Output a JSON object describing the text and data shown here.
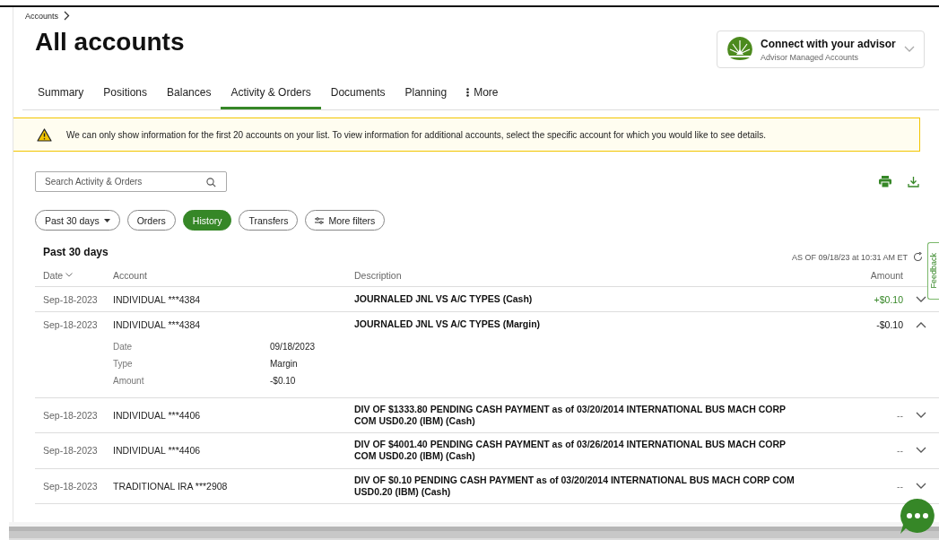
{
  "breadcrumb": {
    "label": "Accounts"
  },
  "page_title": "All accounts",
  "advisor_card": {
    "title": "Connect with your advisor",
    "subtitle": "Advisor Managed Accounts"
  },
  "tabs": [
    {
      "label": "Summary",
      "selected": false
    },
    {
      "label": "Positions",
      "selected": false
    },
    {
      "label": "Balances",
      "selected": false
    },
    {
      "label": "Activity & Orders",
      "selected": true
    },
    {
      "label": "Documents",
      "selected": false
    },
    {
      "label": "Planning",
      "selected": false
    },
    {
      "label": "More",
      "selected": false,
      "kind": "menu"
    }
  ],
  "banner": {
    "text": "We can only show information for the first 20 accounts on your list. To view information for additional accounts, select the specific account for which you would like to see details."
  },
  "search": {
    "placeholder": "Search Activity & Orders"
  },
  "filters": [
    {
      "label": "Past 30 days",
      "kind": "dropdown",
      "selected": false
    },
    {
      "label": "Orders",
      "kind": "chip",
      "selected": false
    },
    {
      "label": "History",
      "kind": "chip",
      "selected": true
    },
    {
      "label": "Transfers",
      "kind": "chip",
      "selected": false
    },
    {
      "label": "More filters",
      "kind": "filters",
      "selected": false
    }
  ],
  "section_title": "Past 30 days",
  "as_of": "AS OF 09/18/23 at 10:31 AM ET",
  "feedback_tab": "Feedback",
  "table": {
    "columns": [
      "Date",
      "Account",
      "Description",
      "Amount"
    ],
    "rows": [
      {
        "date": "Sep-18-2023",
        "account": "INDIVIDUAL ***4384",
        "description": "JOURNALED JNL VS A/C TYPES (Cash)",
        "amount": "+$0.10",
        "kind": "credit",
        "expanded": false
      },
      {
        "date": "Sep-18-2023",
        "account": "INDIVIDUAL ***4384",
        "description": "JOURNALED JNL VS A/C TYPES (Margin)",
        "amount": "-$0.10",
        "kind": "debit",
        "expanded": true,
        "details": [
          {
            "label": "Date",
            "value": "09/18/2023"
          },
          {
            "label": "Type",
            "value": "Margin"
          },
          {
            "label": "Amount",
            "value": "-$0.10"
          }
        ]
      },
      {
        "date": "Sep-18-2023",
        "account": "INDIVIDUAL ***4406",
        "description": "DIV OF $1333.80 PENDING CASH PAYMENT as of 03/20/2014 INTERNATIONAL BUS MACH CORP COM USD0.20 (IBM) (Cash)",
        "amount": "--",
        "kind": "none",
        "expanded": false
      },
      {
        "date": "Sep-18-2023",
        "account": "INDIVIDUAL ***4406",
        "description": "DIV OF $4001.40 PENDING CASH PAYMENT as of 03/26/2014 INTERNATIONAL BUS MACH CORP COM USD0.20 (IBM) (Cash)",
        "amount": "--",
        "kind": "none",
        "expanded": false
      },
      {
        "date": "Sep-18-2023",
        "account": "TRADITIONAL IRA ***2908",
        "description": "DIV OF $0.10 PENDING CASH PAYMENT as of 03/20/2014 INTERNATIONAL BUS MACH CORP COM USD0.20 (IBM) (Cash)",
        "amount": "--",
        "kind": "none",
        "expanded": false
      }
    ]
  }
}
